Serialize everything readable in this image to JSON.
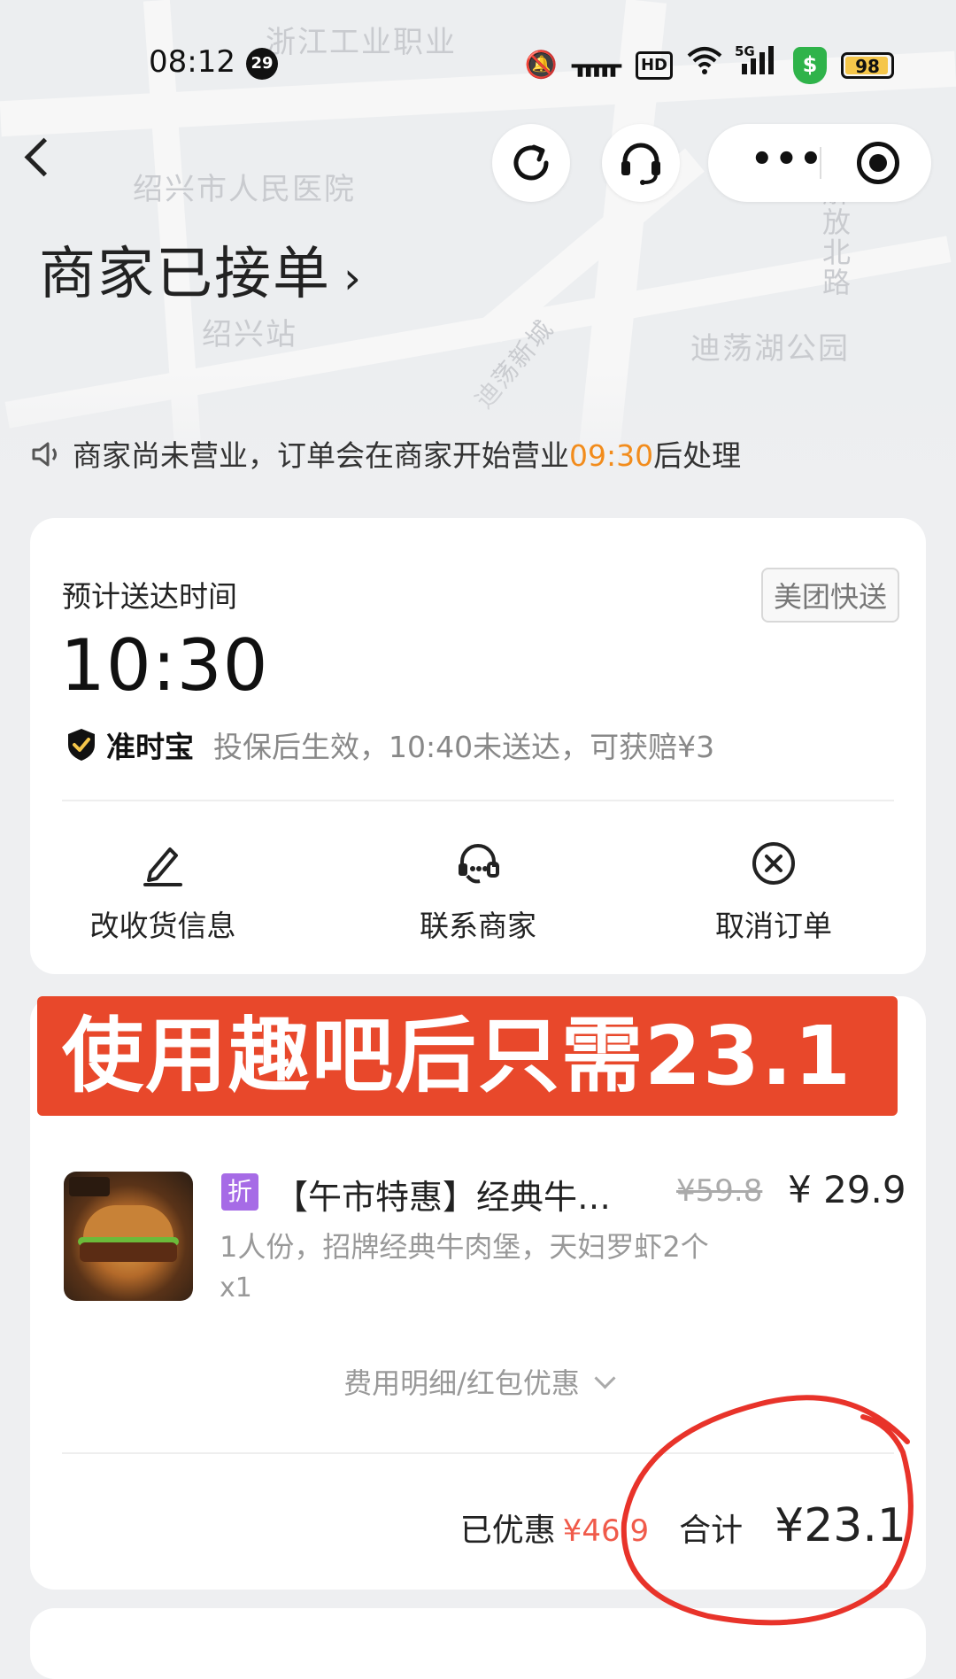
{
  "status_bar": {
    "time": "08:12",
    "notification_count": "29",
    "hd_label": "HD",
    "signal_label": "5G",
    "battery": "98"
  },
  "nav": {
    "icons": [
      "back-icon",
      "refresh-icon",
      "headset-icon",
      "more-icon",
      "target-icon"
    ]
  },
  "map": {
    "labels": [
      "浙江工业职业",
      "绍兴市人民医院",
      "绍兴站",
      "迪荡湖公园",
      "迪荡新城",
      "解放北路"
    ]
  },
  "order": {
    "status": "商家已接单",
    "notice_prefix": "商家尚未营业，订单会在商家开始营业",
    "notice_time": "09:30",
    "notice_suffix": "后处理"
  },
  "delivery": {
    "eta_label": "预计送达时间",
    "eta_time": "10:30",
    "courier": "美团快送",
    "ontime_name": "准时宝",
    "ontime_desc": "投保后生效，10:40未送达，可获赔¥3"
  },
  "actions": [
    {
      "label": "改收货信息",
      "icon": "edit-icon"
    },
    {
      "label": "联系商家",
      "icon": "chat-icon"
    },
    {
      "label": "取消订单",
      "icon": "cancel-icon"
    }
  ],
  "promo_banner": "使用趣吧后只需23.1",
  "item": {
    "discount_tag": "折",
    "name": "【午市特惠】经典牛…",
    "original_price": "¥59.8",
    "price": "¥ 29.9",
    "desc": "1人份，招牌经典牛肉堡，天妇罗虾2个",
    "qty": "x1"
  },
  "fees": {
    "detail_link": "费用明细/红包优惠",
    "saved_label": "已优惠",
    "saved_value": "¥46.9",
    "total_label": "合计",
    "total_value": "¥23.1"
  },
  "colors": {
    "accent_orange": "#f28c1c",
    "promo_red": "#e8482b",
    "discount_purple": "#a66be6",
    "saved_red": "#f05a4a"
  }
}
